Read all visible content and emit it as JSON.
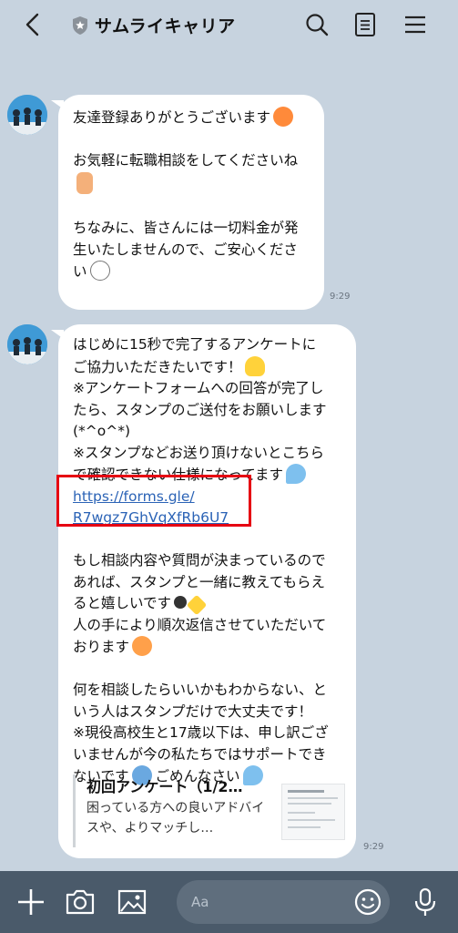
{
  "header": {
    "title": "サムライキャリア"
  },
  "messages": [
    {
      "lines": [
        "友達登録ありがとうございます",
        "",
        "お気軽に転職相談をしてくださいね",
        "",
        "",
        "ちなみに、皆さんには一切料金が発",
        "生いたしませんので、ご安心くださ",
        "い"
      ],
      "time": "9:29"
    },
    {
      "lines_top": [
        "はじめに15秒で完了するアンケートに",
        "ご協力いただきたいです！",
        "※アンケートフォームへの回答が完了し",
        "たら、スタンプのご送付をお願いします",
        "(*^o^*)",
        "※スタンプなどお送り頂けないとこちら",
        "で確認できない仕様になってます"
      ],
      "link_lines": [
        "https://forms.gle/",
        "R7wgz7GhVqXfRb6U7"
      ],
      "lines_bottom": [
        "",
        "もし相談内容や質問が決まっているので",
        "あれば、スタンプと一緒に教えてもらえ",
        "ると嬉しいです",
        "人の手により順次返信させていただいて",
        "おります",
        "",
        "何を相談したらいいかもわからない、と",
        "いう人はスタンプだけで大丈夫です！",
        "※現役高校生と17歳以下は、申し訳ござ",
        "いませんが今の私たちではサポートでき",
        "ないです",
        "ごめんなさい"
      ],
      "preview": {
        "title": "初回アンケート（1/2…",
        "description": "困っている方への良いアドバイスや、よりマッチし…"
      },
      "time": "9:29"
    }
  ],
  "input": {
    "placeholder": "Aa"
  },
  "colors": {
    "background": "#c7d3df",
    "bubble": "#ffffff",
    "link": "#2b63b6",
    "highlight_box": "#e60012",
    "bottom_bar": "#4a5a6a"
  },
  "icons": [
    "back-chevron-icon",
    "shield-icon",
    "search-icon",
    "notes-icon",
    "menu-icon",
    "plus-icon",
    "camera-icon",
    "image-icon",
    "emoji-icon",
    "microphone-icon"
  ]
}
